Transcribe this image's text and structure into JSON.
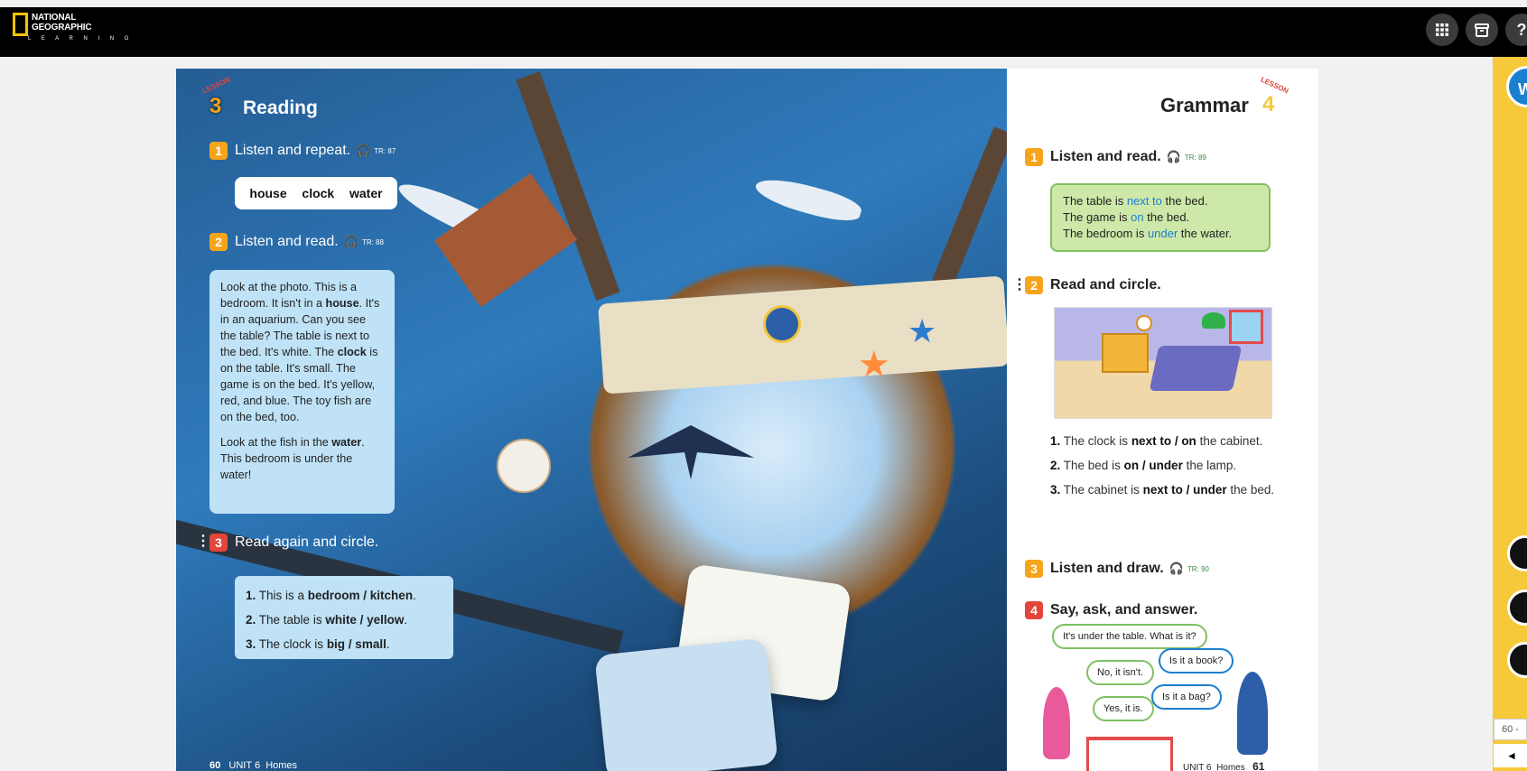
{
  "brand": {
    "logo_line1": "NATIONAL",
    "logo_line2": "GEOGRAPHIC",
    "logo_line3": "L E A R N I N G"
  },
  "topbar_icons": [
    "grid-icon",
    "archive-icon",
    "help-icon"
  ],
  "topbar_help_label": "?",
  "sidebar": {
    "badge_label": "W",
    "page_indicator": "60 -",
    "prev_label": "◄"
  },
  "left_page": {
    "lesson_tag": "LESSON",
    "lesson_number": "3",
    "title": "Reading",
    "activity1": {
      "number": "1",
      "label": "Listen and repeat.",
      "track": "TR: 87"
    },
    "words": [
      "house",
      "clock",
      "water"
    ],
    "activity2": {
      "number": "2",
      "label": "Listen and read.",
      "track": "TR: 88"
    },
    "story_p1": {
      "s1": "Look at the photo. This is a bedroom. It isn't in a ",
      "w1": "house",
      "s2": ". It's in an aquarium. Can you see the table? The table is next to the bed. It's white. The ",
      "w2": "clock",
      "s3": " is on the table. It's small. The game is on the bed. It's yellow, red, and blue. The toy fish are on the bed, too."
    },
    "story_p2": {
      "s1": "Look at the fish in the ",
      "w1": "water",
      "s2": ". This bedroom is under the water!"
    },
    "activity3": {
      "number": "3",
      "label": "Read again and circle."
    },
    "circle_items": [
      {
        "num": "1.",
        "pre": "This is a ",
        "opts": "bedroom / kitchen",
        "post": "."
      },
      {
        "num": "2.",
        "pre": "The table is ",
        "opts": "white / yellow",
        "post": "."
      },
      {
        "num": "3.",
        "pre": "The clock is ",
        "opts": "big / small",
        "post": "."
      }
    ],
    "footer": {
      "page": "60",
      "unit": "UNIT 6",
      "topic": "Homes"
    }
  },
  "right_page": {
    "lesson_tag": "LESSON",
    "lesson_number": "4",
    "title": "Grammar",
    "activity1": {
      "number": "1",
      "label": "Listen and read.",
      "track": "TR: 89"
    },
    "grammar_lines": [
      {
        "pre": "The table is ",
        "hl": "next to",
        "post": " the bed."
      },
      {
        "pre": "The game is ",
        "hl": "on",
        "post": " the bed."
      },
      {
        "pre": "The bedroom is ",
        "hl": "under",
        "post": " the water."
      }
    ],
    "activity2": {
      "number": "2",
      "label": "Read and circle."
    },
    "circle_items": [
      {
        "num": "1.",
        "pre": "The clock is ",
        "opts": "next to / on",
        "post": " the cabinet."
      },
      {
        "num": "2.",
        "pre": "The bed is ",
        "opts": "on / under",
        "post": " the lamp."
      },
      {
        "num": "3.",
        "pre": "The cabinet is ",
        "opts": "next to / under",
        "post": " the bed."
      }
    ],
    "activity3": {
      "number": "3",
      "label": "Listen and draw.",
      "track": "TR: 90"
    },
    "activity4": {
      "number": "4",
      "label": "Say, ask, and answer."
    },
    "bubbles": {
      "b1": "It's under the table. What is it?",
      "b2": "Is it a book?",
      "b3": "No, it isn't.",
      "b4": "Is it a bag?",
      "b5": "Yes, it is."
    },
    "footer": {
      "unit": "UNIT 6",
      "topic": "Homes",
      "page": "61"
    }
  },
  "colors": {
    "accent_orange": "#f6a41a",
    "accent_red": "#e4453a",
    "highlight_blue": "#1b7fd0",
    "grammar_green": "#cde8a8",
    "sidebar_yellow": "#f6c93b"
  }
}
